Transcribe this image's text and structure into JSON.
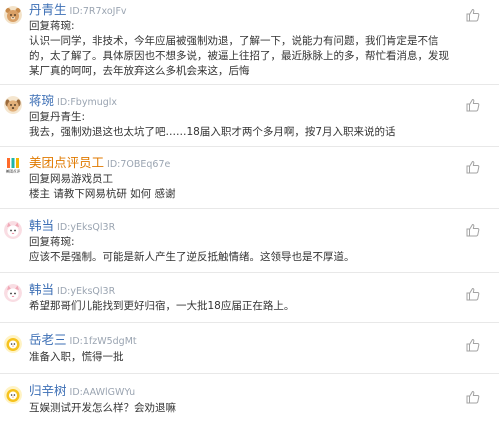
{
  "comments": [
    {
      "username": "丹青生",
      "user_id": "ID:7R7xoJFv",
      "reply_to": "回复蒋琬:",
      "text": "认识一同学，非技术，今年应届被强制劝退，了解一下，说能力有问题，我们肯定是不信的，太了解了。具体原因也不想多说，被逼上往招了，最近脉脉上的多，帮忙看消息，发现某厂真的呵呵，去年放弃这么多机会来这，后悔"
    },
    {
      "username": "蒋琬",
      "user_id": "ID:Fbymuglx",
      "reply_to": "回复丹青生:",
      "text": "我去，强制劝退这也太坑了吧……18届入职才两个多月啊，按7月入职来说的话"
    },
    {
      "username": "美团点评员工",
      "user_id": "ID:7OBEq67e",
      "avatar_caption": "美团点评",
      "reply_to": "回复网易游戏员工",
      "text": "楼主 请教下网易杭研 如何 感谢"
    },
    {
      "username": "韩当",
      "user_id": "ID:yEksQl3R",
      "reply_to": "回复蒋琬:",
      "text": "应该不是强制。可能是新人产生了逆反抵触情绪。这领导也是不厚道。"
    },
    {
      "username": "韩当",
      "user_id": "ID:yEksQl3R",
      "reply_to": "",
      "text": "希望那哥们儿能找到更好归宿，一大批18应届正在路上。"
    },
    {
      "username": "岳老三",
      "user_id": "ID:1fzW5dgMt",
      "reply_to": "",
      "text": "准备入职，慌得一批"
    },
    {
      "username": "归辛树",
      "user_id": "ID:AAWlGWYu",
      "reply_to": "",
      "text": "互娱测试开发怎么样？会劝退嘛"
    }
  ],
  "colors": {
    "username": "#3d6fb5",
    "username_highlight": "#e07a00",
    "user_id": "#9aa4b1",
    "text": "#333333",
    "like_icon": "#a3a3a3"
  },
  "icons": {
    "like": "thumbs-up-icon",
    "avatar_1": "bear-avatar-icon",
    "avatar_2": "dog-avatar-icon",
    "avatar_3": "meituan-dianping-logo",
    "avatar_4": "cat-avatar-icon",
    "avatar_5": "cat-avatar-icon",
    "avatar_6": "chick-avatar-icon",
    "avatar_7": "chick-avatar-icon"
  }
}
